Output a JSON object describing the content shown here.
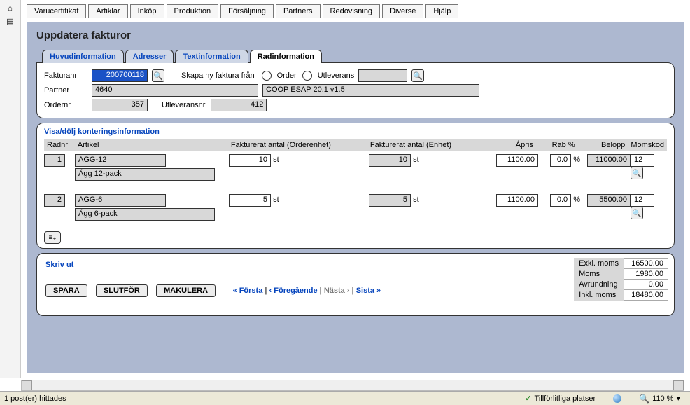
{
  "menu": [
    "Varucertifikat",
    "Artiklar",
    "Inköp",
    "Produktion",
    "Försäljning",
    "Partners",
    "Redovisning",
    "Diverse",
    "Hjälp"
  ],
  "page_title": "Uppdatera fakturor",
  "tabs": {
    "huvud": "Huvudinformation",
    "adresser": "Adresser",
    "textinfo": "Textinformation",
    "radinfo": "Radinformation"
  },
  "header": {
    "fakturanr_label": "Fakturanr",
    "fakturanr": "200700118",
    "skapa_label": "Skapa ny faktura från",
    "order_label": "Order",
    "utleverans_label": "Utleverans",
    "partner_label": "Partner",
    "partner_nr": "4640",
    "partner_name": "COOP ESAP 20.1 v1.5",
    "ordernr_label": "Ordernr",
    "ordernr": "357",
    "utleveransnr_label": "Utleveransnr",
    "utleveransnr": "412"
  },
  "lines": {
    "toggle_label": "Visa/dölj konteringsinformation",
    "columns": {
      "radnr": "Radnr",
      "artikel": "Artikel",
      "fao": "Fakturerat antal (Orderenhet)",
      "fae": "Fakturerat antal (Enhet)",
      "apris": "Ápris",
      "rab": "Rab %",
      "belopp": "Belopp",
      "momskod": "Momskod"
    },
    "unit_st": "st",
    "pct": "%",
    "rows": [
      {
        "radnr": "1",
        "artikel_kod": "AGG-12",
        "artikel_namn": "Ägg 12-pack",
        "fao": "10",
        "fae": "10",
        "apris": "1100.00",
        "rab": "0.0",
        "belopp": "11000.00",
        "momskod": "12"
      },
      {
        "radnr": "2",
        "artikel_kod": "AGG-6",
        "artikel_namn": "Ägg 6-pack",
        "fao": "5",
        "fae": "5",
        "apris": "1100.00",
        "rab": "0.0",
        "belopp": "5500.00",
        "momskod": "12"
      }
    ]
  },
  "bottom": {
    "skriv_ut": "Skriv ut",
    "spara": "SPARA",
    "slutfor": "SLUTFÖR",
    "makulera": "MAKULERA",
    "nav_first": "« Första",
    "nav_prev": "‹ Föregående",
    "nav_next": "Nästa ›",
    "nav_last": "Sista »",
    "sep": " | ",
    "totals": {
      "exkl_label": "Exkl. moms",
      "exkl": "16500.00",
      "moms_label": "Moms",
      "moms": "1980.00",
      "avr_label": "Avrundning",
      "avr": "0.00",
      "inkl_label": "Inkl. moms",
      "inkl": "18480.00"
    }
  },
  "status": {
    "left": "1 post(er) hittades",
    "trusted": "Tillförlitliga platser",
    "zoom": "110 %"
  },
  "icons": {
    "search": "🔍",
    "home": "⌂",
    "grip": "▤",
    "addrow": "≡₊",
    "dropdown": "▾"
  }
}
